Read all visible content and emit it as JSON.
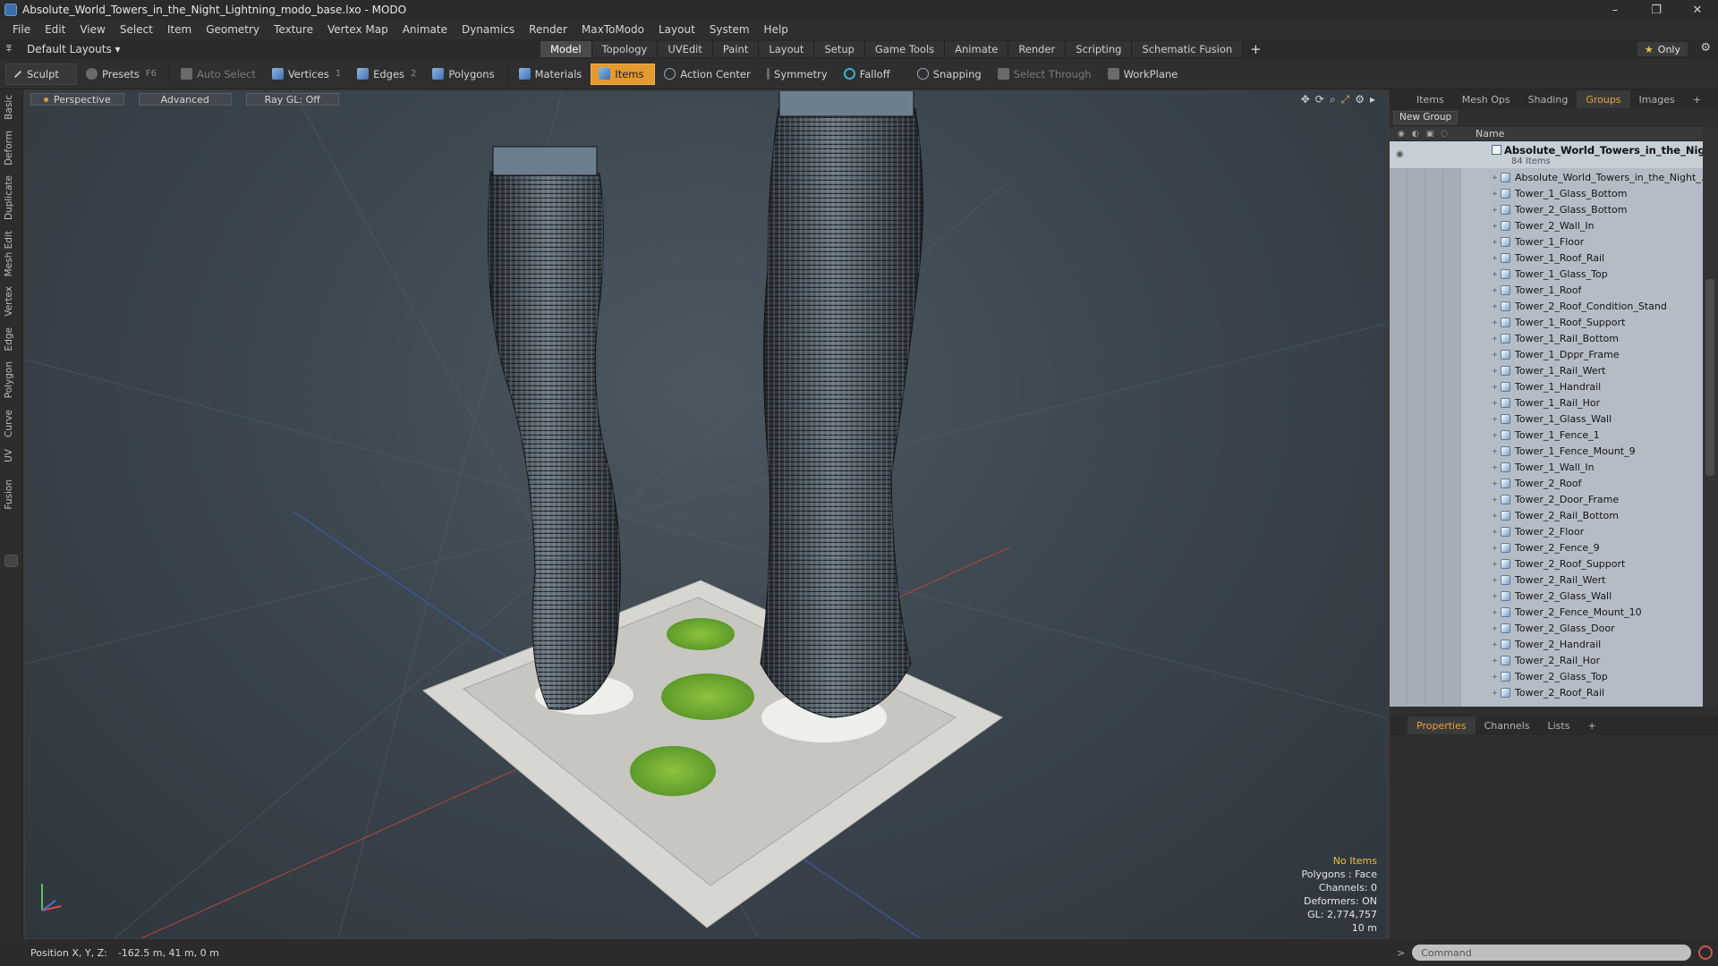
{
  "window": {
    "title": "Absolute_World_Towers_in_the_Night_Lightning_modo_base.lxo - MODO",
    "controls": [
      "–",
      "❐",
      "✕"
    ]
  },
  "menu": [
    "File",
    "Edit",
    "View",
    "Select",
    "Item",
    "Geometry",
    "Texture",
    "Vertex Map",
    "Animate",
    "Dynamics",
    "Render",
    "MaxToModo",
    "Layout",
    "System",
    "Help"
  ],
  "layout": {
    "selector": "Default Layouts ▾",
    "tabs": [
      "Model",
      "Topology",
      "UVEdit",
      "Paint",
      "Layout",
      "Setup",
      "Game Tools",
      "Animate",
      "Render",
      "Scripting",
      "Schematic Fusion"
    ],
    "active_tab": "Model",
    "plus": "+",
    "only_star": "★",
    "only_label": "Only",
    "gear": "⚙"
  },
  "toolbar": {
    "sculpt": "Sculpt",
    "presets": "Presets",
    "presets_key": "F6",
    "auto_select": "Auto Select",
    "vertices": "Vertices",
    "vertices_key": "1",
    "edges": "Edges",
    "edges_key": "2",
    "polygons": "Polygons",
    "materials": "Materials",
    "items": "Items",
    "action_center": "Action Center",
    "symmetry": "Symmetry",
    "falloff": "Falloff",
    "snapping": "Snapping",
    "select_through": "Select Through",
    "workplane": "WorkPlane"
  },
  "left_tabs": [
    "Basic",
    "Deform",
    "Duplicate",
    "Mesh Edit",
    "Vertex",
    "Edge",
    "Polygon",
    "Curve",
    "UV",
    "Fusion"
  ],
  "viewport": {
    "perspective": "Perspective",
    "advanced": "Advanced",
    "raygl": "Ray GL: Off",
    "hud": {
      "no_items": "No Items",
      "polygons": "Polygons : Face",
      "channels": "Channels: 0",
      "deformers": "Deformers: ON",
      "gl": "GL: 2,774,757",
      "scale": "10 m"
    }
  },
  "right_panel": {
    "tabs": [
      "Items",
      "Mesh Ops",
      "Shading",
      "Groups",
      "Images",
      "+"
    ],
    "active_tab": "Groups",
    "new_group": "New Group",
    "name_header": "Name",
    "group_name": "Absolute_World_Towers_in_the_Nig...",
    "group_count": "84 Items",
    "items": [
      "Absolute_World_Towers_in_the_Night_...",
      "Tower_1_Glass_Bottom",
      "Tower_2_Glass_Bottom",
      "Tower_2_Wall_In",
      "Tower_1_Floor",
      "Tower_1_Roof_Rail",
      "Tower_1_Glass_Top",
      "Tower_1_Roof",
      "Tower_2_Roof_Condition_Stand",
      "Tower_1_Roof_Support",
      "Tower_1_Rail_Bottom",
      "Tower_1_Dppr_Frame",
      "Tower_1_Rail_Wert",
      "Tower_1_Handrail",
      "Tower_1_Rail_Hor",
      "Tower_1_Glass_Wall",
      "Tower_1_Fence_1",
      "Tower_1_Fence_Mount_9",
      "Tower_1_Wall_In",
      "Tower_2_Roof",
      "Tower_2_Door_Frame",
      "Tower_2_Rail_Bottom",
      "Tower_2_Floor",
      "Tower_2_Fence_9",
      "Tower_2_Roof_Support",
      "Tower_2_Rail_Wert",
      "Tower_2_Glass_Wall",
      "Tower_2_Fence_Mount_10",
      "Tower_2_Glass_Door",
      "Tower_2_Handrail",
      "Tower_2_Rail_Hor",
      "Tower_2_Glass_Top",
      "Tower_2_Roof_Rail"
    ],
    "bottom_tabs": [
      "Properties",
      "Channels",
      "Lists",
      "+"
    ],
    "bottom_active": "Properties"
  },
  "status": {
    "position_label": "Position X, Y, Z:",
    "position_value": "-162.5 m, 41 m, 0 m"
  },
  "command": {
    "prompt": ">",
    "placeholder": "Command"
  },
  "colors": {
    "accent": "#e59a2e",
    "list_bg": "#b4bdc6",
    "viewport_bg": "#3c464f"
  }
}
